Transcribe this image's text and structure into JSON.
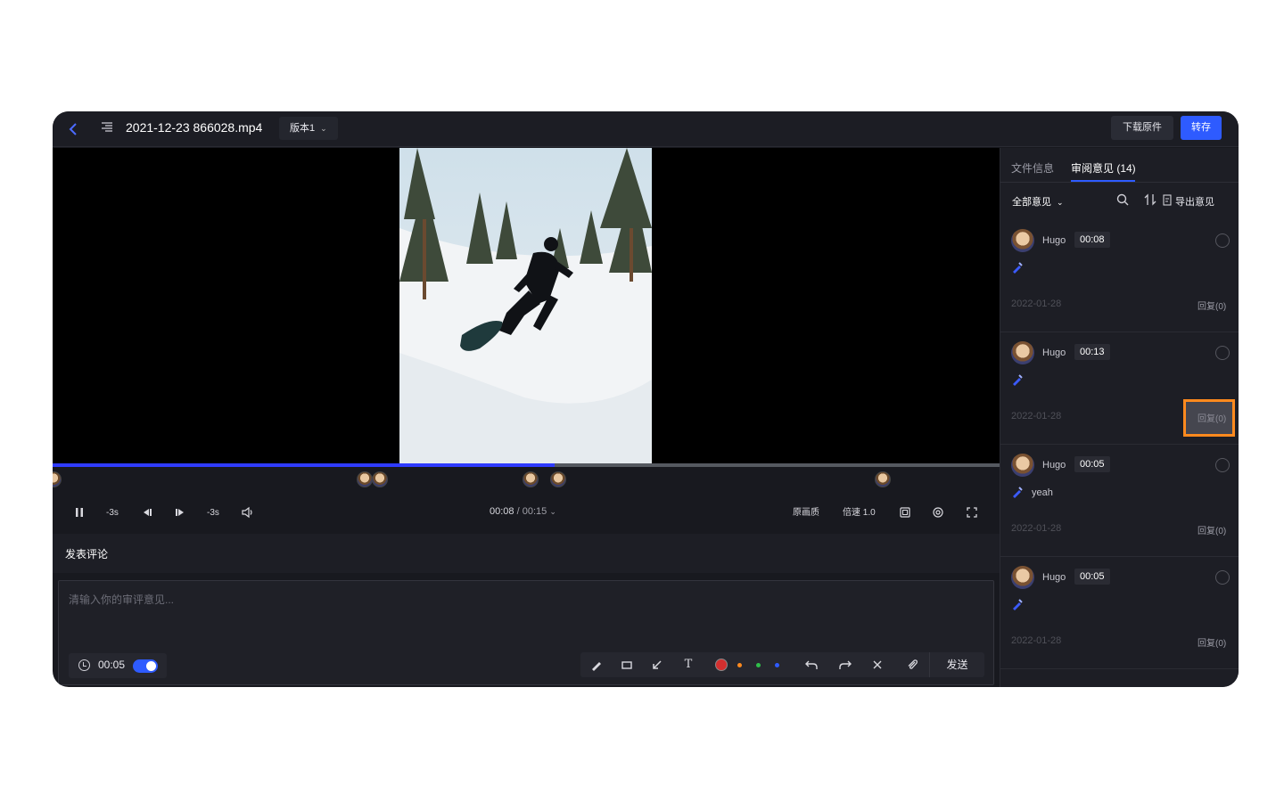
{
  "header": {
    "title": "2021-12-23 866028.mp4",
    "version": "版本1",
    "download_label": "下载原件",
    "save_label": "转存"
  },
  "player": {
    "progress_fraction": 0.53,
    "rewind_label": "-3s",
    "forward_label": "-3s",
    "current_time": "00:08",
    "separator": "/",
    "total_time": "00:15",
    "quality_label": "原画质",
    "speed_label": "倍速 1.0"
  },
  "composer": {
    "heading": "发表评论",
    "placeholder": "清输入你的审评意见...",
    "timestamp": "00:05",
    "timestamp_enabled": true,
    "send_label": "发送",
    "colors": [
      "#d32f2f",
      "#ff8a1e",
      "#2fbf4a",
      "#2e5bff"
    ]
  },
  "sidebar": {
    "tab_info": "文件信息",
    "tab_review": "审阅意见 (14)",
    "filter_label": "全部意见",
    "export_label": "导出意见",
    "comments": [
      {
        "user": "Hugo",
        "time": "00:08",
        "text": "",
        "date": "2022-01-28",
        "reply": "回复(0)"
      },
      {
        "user": "Hugo",
        "time": "00:13",
        "text": "",
        "date": "2022-01-28",
        "reply": "回复(0)"
      },
      {
        "user": "Hugo",
        "time": "00:05",
        "text": "yeah",
        "date": "2022-01-28",
        "reply": "回复(0)"
      },
      {
        "user": "Hugo",
        "time": "00:05",
        "text": "",
        "date": "2022-01-28",
        "reply": "回复(0)"
      }
    ]
  }
}
